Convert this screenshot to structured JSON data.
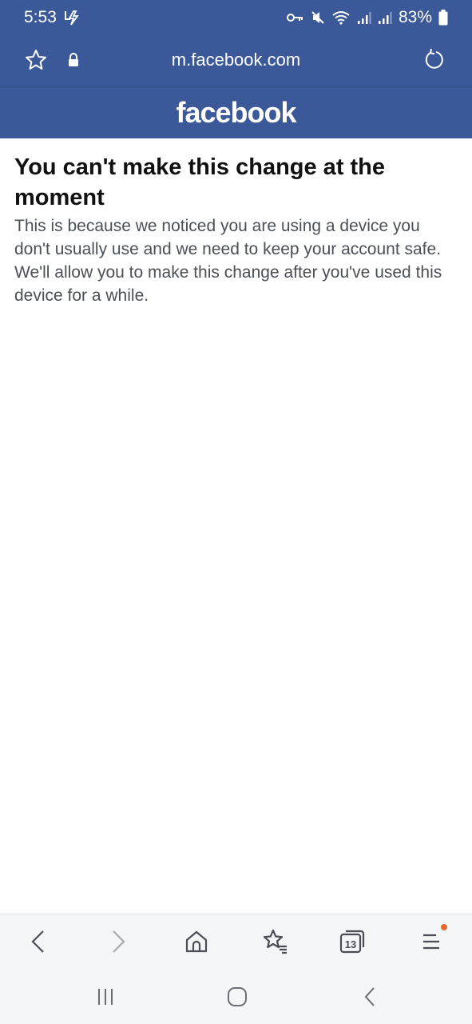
{
  "status_bar": {
    "time": "5:53",
    "battery": "83%",
    "icons": [
      "charging-icon",
      "key-icon",
      "mute-icon",
      "wifi-icon",
      "signal-icon",
      "signal-icon",
      "battery-icon"
    ]
  },
  "browser": {
    "url": "m.facebook.com",
    "icons": [
      "star-icon",
      "lock-icon",
      "reload-icon"
    ]
  },
  "header": {
    "logo": "facebook",
    "bg_color": "#3b5998"
  },
  "message": {
    "title": "You can't make this change at the moment",
    "body": "This is because we noticed you are using a device you don't usually use and we need to keep your account safe. We'll allow you to make this change after you've used this device for a while."
  },
  "toolbar": {
    "tab_count": "13",
    "icons": [
      "back-icon",
      "forward-icon",
      "home-icon",
      "bookmarks-icon",
      "tabs-icon",
      "menu-icon"
    ],
    "notification_color": "#e8692d"
  },
  "nav": {
    "icons": [
      "recents-icon",
      "home-icon",
      "back-icon"
    ]
  }
}
